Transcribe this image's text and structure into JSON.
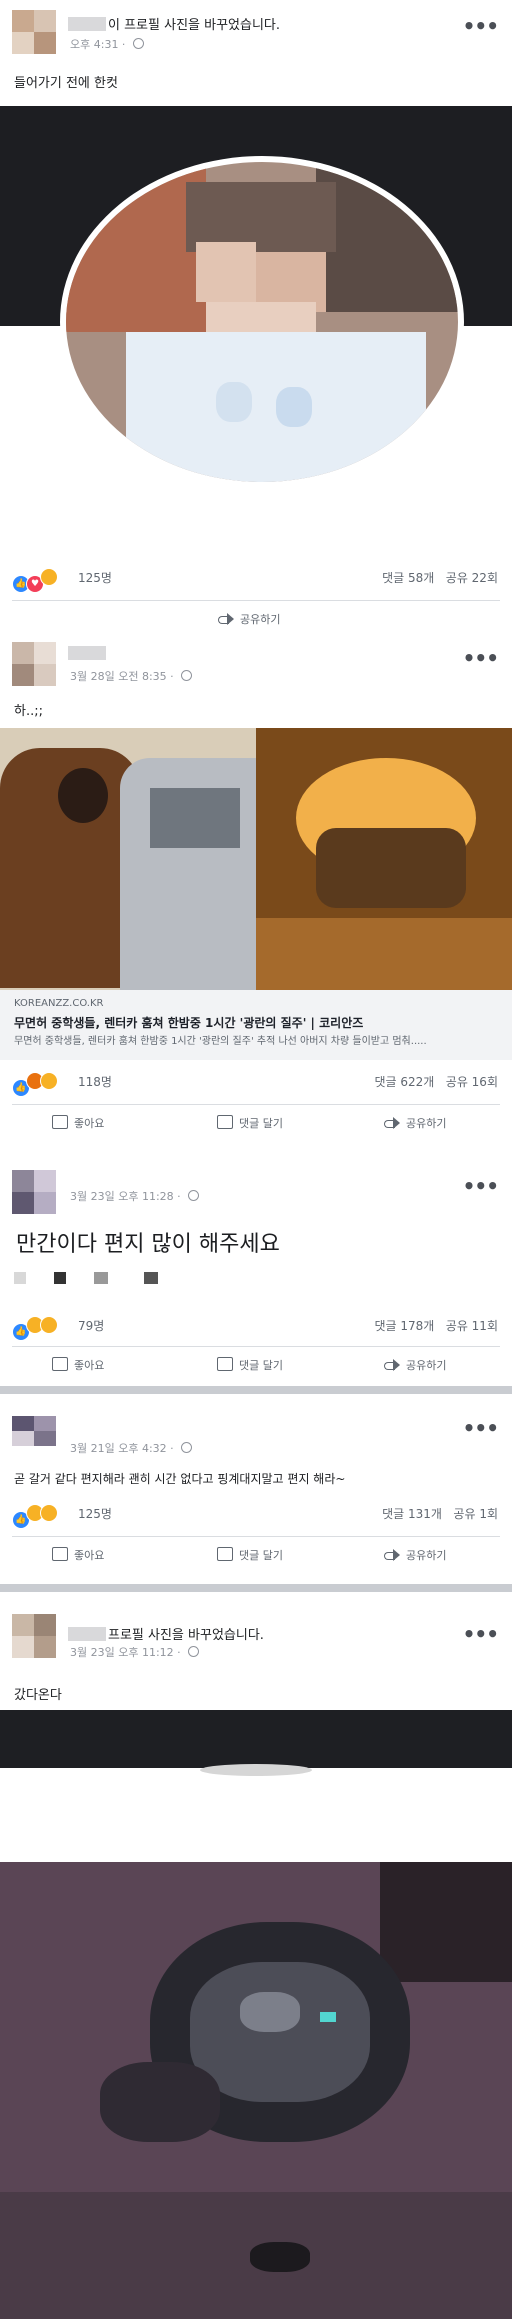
{
  "posts": [
    {
      "name_suffix": "이 프로필 사진을 바꾸었습니다.",
      "time": "오후 4:31 · ",
      "text": "들어가기 전에 한컷",
      "reaction_count": "125명",
      "comments": "댓글 58개",
      "shares": "공유 22회",
      "share_action": "공유하기"
    },
    {
      "time": "3월 28일 오전 8:35 · ",
      "text": "하..;;",
      "link_domain": "KOREANZZ.CO.KR",
      "link_title": "무면허 중학생들, 렌터카 훔쳐 한밤중 1시간 '광란의 질주' | 코리안즈",
      "link_desc": "무면허 중학생들, 렌터카 훔쳐 한밤중 1시간 '광란의 질주' 추적 나선 아버지 차량 들이받고 멈춰.....",
      "reaction_count": "118명",
      "comments": "댓글 622개",
      "shares": "공유 16회"
    },
    {
      "time": "3월 23일 오후 11:28 · ",
      "text": "만간이다 편지 많이 해주세요",
      "reaction_count": "79명",
      "comments": "댓글 178개",
      "shares": "공유 11회"
    },
    {
      "time": "3월 21일 오후 4:32 · ",
      "text": "곧 갈거 같다 편지해라 괜히 시간 없다고 핑계대지말고 편지 해라~",
      "reaction_count": "125명",
      "comments": "댓글 131개",
      "shares": "공유 1회"
    },
    {
      "name_suffix": "프로필 사진을 바꾸었습니다.",
      "time": "3월 23일 오후 11:12 · ",
      "text": "갔다온다"
    }
  ],
  "actions": {
    "like": "좋아요",
    "comment": "댓글 달기",
    "share": "공유하기"
  },
  "icons": {
    "more": "more-options-icon",
    "globe": "globe-icon",
    "like": "thumbs-up-icon",
    "comment": "comment-icon",
    "share": "share-arrow-icon"
  }
}
